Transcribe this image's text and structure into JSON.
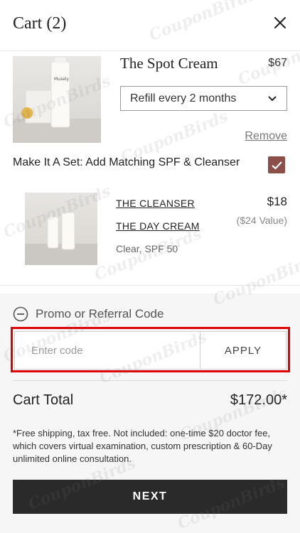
{
  "header": {
    "title": "Cart (2)",
    "close_icon": "close-icon"
  },
  "item1": {
    "name": "The Spot Cream",
    "price": "$67",
    "refill_select": "Refill every 2 months",
    "remove_label": "Remove",
    "image_label": "Musely"
  },
  "set_offer": {
    "label": "Make It A Set: Add Matching SPF & Cleanser",
    "checked": true
  },
  "item2": {
    "links": [
      "THE CLEANSER",
      "THE DAY CREAM"
    ],
    "price": "$18",
    "value": "($24 Value)",
    "variant": "Clear, SPF 50"
  },
  "promo": {
    "toggle_label": "Promo or Referral Code",
    "placeholder": "Enter code",
    "apply_label": "APPLY"
  },
  "total": {
    "label": "Cart Total",
    "value": "$172.00*"
  },
  "note": "*Free shipping, tax free. Not included: one-time $20 doctor fee, which covers virtual examination, custom prescription & 60-Day unlimited online consultation.",
  "cta": {
    "next_label": "NEXT"
  },
  "watermark": "CouponBirds",
  "colors": {
    "accent_checkbox": "#8b4e48",
    "cta_bg": "#2a2a2a",
    "highlight": "#e00000"
  }
}
